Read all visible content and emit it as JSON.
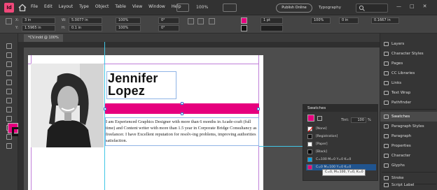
{
  "app": {
    "logo": "Id",
    "menus": [
      "File",
      "Edit",
      "Layout",
      "Type",
      "Object",
      "Table",
      "View",
      "Window",
      "Help"
    ],
    "zoom": "100%",
    "publish_label": "Publish Online",
    "workspace": "Typography",
    "window_controls": [
      "—",
      "□",
      "✕"
    ]
  },
  "control_bar": {
    "x_label": "X:",
    "x_value": "3 in",
    "y_label": "Y:",
    "y_value": "1.5965 in",
    "w_label": "W:",
    "w_value": "5.0077 in",
    "h_label": "H:",
    "h_value": "0.1 in",
    "scale_x": "100%",
    "scale_y": "100%",
    "angle": "0°",
    "shear": "0°",
    "stroke_weight": "1 pt",
    "ref_value": "0 in",
    "opacity": "100%",
    "gap_value": "0.1667 in"
  },
  "document": {
    "tab_label": "*CV.indd @ 100%",
    "name_line1": "Jennifer",
    "name_line2": "Lopez",
    "bio": "I am Experienced Graphics Designer with more than 6 months in Acade-craft (full time) and Content writer with more than 1.5 year in Corporate Bridge Consultancy as freelancer. I have Excellent reputation for resolv-ing problems, improving authorities satisfaction."
  },
  "swatches": {
    "title": "Swatches",
    "tint_label": "Tint:",
    "tint_value": "100",
    "tint_unit": "%",
    "rows": [
      {
        "label": "[None]"
      },
      {
        "label": "[Registration]"
      },
      {
        "label": "[Paper]"
      },
      {
        "label": "[Black]"
      },
      {
        "label": "C=100 M=0 Y=0 K=0"
      },
      {
        "label": "C=0 M=100 Y=0 K=0"
      }
    ],
    "tooltip": "C=0, M=100, Y=0, K=0"
  },
  "panels": {
    "items": [
      {
        "label": "Layers"
      },
      {
        "label": "Character Styles"
      },
      {
        "label": "Pages"
      },
      {
        "label": "CC Libraries"
      },
      {
        "label": "Links"
      },
      {
        "label": "Text Wrap"
      },
      {
        "label": "Pathfinder"
      },
      {
        "label": "Swatches"
      },
      {
        "label": "Paragraph Styles"
      },
      {
        "label": "Paragraph"
      },
      {
        "label": "Properties"
      },
      {
        "label": "Character"
      },
      {
        "label": "Glyphs"
      },
      {
        "label": "Stroke"
      },
      {
        "label": "Script Label"
      }
    ]
  },
  "colors": {
    "magenta": "#e6007e",
    "cyan_swatch": "#00a0e3",
    "selection": "#20548f"
  },
  "icons": {
    "home": "home-icon",
    "search": "search-icon",
    "fill": "fill-swatch-icon",
    "stroke": "stroke-swatch-icon"
  }
}
